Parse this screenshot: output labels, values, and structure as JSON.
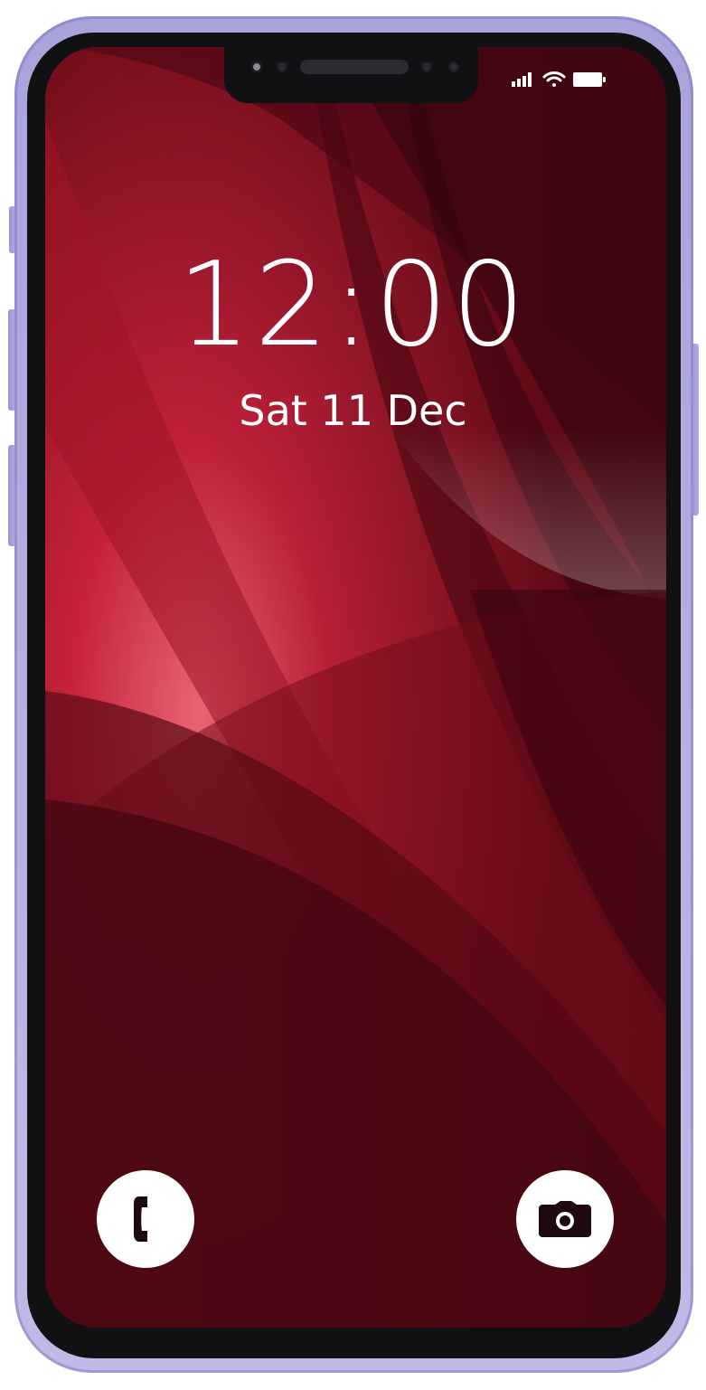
{
  "lock_screen": {
    "time": "12:00",
    "date": "Sat 11 Dec"
  },
  "status_bar": {
    "icons": [
      "signal-icon",
      "wifi-icon",
      "battery-icon"
    ]
  },
  "quick_actions": {
    "left_icon": "phone-icon",
    "right_icon": "camera-icon"
  },
  "colors": {
    "frame": "#b3aae0",
    "wallpaper_dark": "#520a14",
    "wallpaper_mid": "#8a1020",
    "wallpaper_bright": "#e0304a",
    "text": "#ffffff"
  }
}
